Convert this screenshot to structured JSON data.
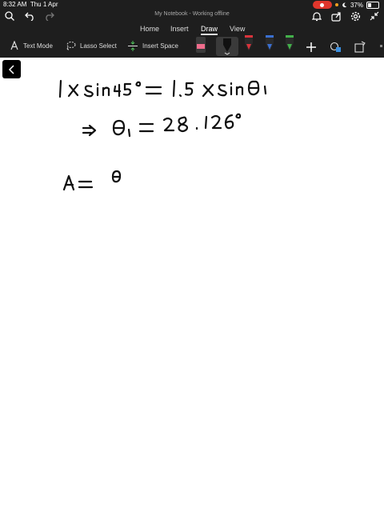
{
  "status": {
    "time": "8:32 AM",
    "date": "Thu 1 Apr",
    "battery": "37%"
  },
  "app": {
    "title": "My Notebook - Working offline"
  },
  "tabs": [
    {
      "label": "Home"
    },
    {
      "label": "Insert"
    },
    {
      "label": "Draw",
      "active": true
    },
    {
      "label": "View"
    }
  ],
  "ribbon": {
    "text_mode": "Text Mode",
    "lasso_select": "Lasso Select",
    "insert_space": "Insert Space"
  },
  "colors": {
    "bar_bg": "#1e1e1e",
    "pen_red": "#d9333b",
    "pen_blue": "#3a6fd0",
    "pen_green": "#43b04a",
    "highlighter": "#f06c8c",
    "record": "#e0362c"
  },
  "icons": [
    "search-icon",
    "undo-icon",
    "redo-icon",
    "bell-icon",
    "share-icon",
    "gear-icon",
    "collapse-icon",
    "text-mode-icon",
    "lasso-icon",
    "insert-space-icon",
    "add-icon",
    "shapes-icon",
    "convert-icon",
    "back-chevron-icon"
  ]
}
